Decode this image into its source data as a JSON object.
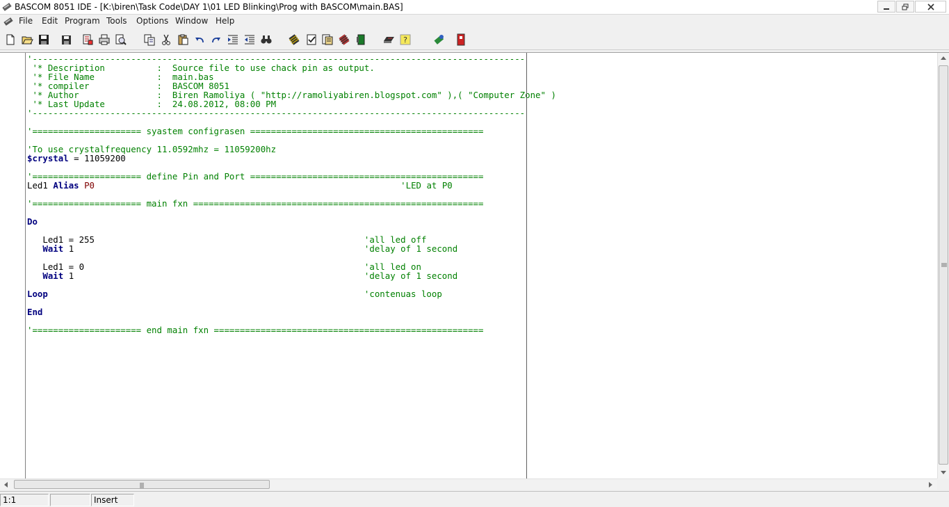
{
  "window": {
    "title": "BASCOM 8051 IDE - [K:\\biren\\Task Code\\DAY 1\\01 LED Blinking\\Prog with BASCOM\\main.BAS]",
    "controls": [
      "minimize",
      "restore",
      "close"
    ]
  },
  "menu": {
    "items": [
      "File",
      "Edit",
      "Program",
      "Tools",
      "Options",
      "Window",
      "Help"
    ]
  },
  "toolbar": {
    "buttons": [
      "new-file-icon",
      "open-folder-icon",
      "save-icon",
      "save-all-icon",
      "print-preview-icon",
      "print-icon",
      "zoom-icon",
      "copy-icon",
      "cut-icon",
      "paste-icon",
      "undo-icon",
      "redo-icon",
      "indent-icon",
      "outdent-icon",
      "find-icon",
      "compile-icon",
      "syntax-check-icon",
      "report-icon",
      "simulate-icon",
      "program-chip-icon",
      "terminal-icon",
      "help-icon",
      "lcd-designer-icon",
      "exit-icon"
    ]
  },
  "editor": {
    "lines": [
      [
        {
          "c": "cm",
          "t": "'-----------------------------------------------------------------------------------------------"
        }
      ],
      [
        {
          "c": "cm",
          "t": " '* Description          :  Source file to use chack pin as output."
        }
      ],
      [
        {
          "c": "cm",
          "t": " '* File Name            :  main.bas"
        }
      ],
      [
        {
          "c": "cm",
          "t": " '* compiler             :  BASCOM 8051"
        }
      ],
      [
        {
          "c": "cm",
          "t": " '* Author               :  Biren Ramoliya ( \"http://ramoliyabiren.blogspot.com\" ),( \"Computer Zone\" )"
        }
      ],
      [
        {
          "c": "cm",
          "t": " '* Last Update          :  24.08.2012, 08:00 PM"
        }
      ],
      [
        {
          "c": "cm",
          "t": "'-----------------------------------------------------------------------------------------------"
        }
      ],
      [],
      [
        {
          "c": "cm",
          "t": "'===================== syastem configrasen ============================================="
        }
      ],
      [],
      [
        {
          "c": "cm",
          "t": "'To use crystalfrequency 11.0592mhz = 11059200hz"
        }
      ],
      [
        {
          "c": "kw",
          "t": "$crystal"
        },
        {
          "c": "tx",
          "t": " = 11059200"
        }
      ],
      [],
      [
        {
          "c": "cm",
          "t": "'===================== define Pin and Port ============================================="
        }
      ],
      [
        {
          "c": "tx",
          "t": "Led1 "
        },
        {
          "c": "kw",
          "t": "Alias"
        },
        {
          "c": "tx",
          "t": " "
        },
        {
          "c": "pin",
          "t": "P0"
        },
        {
          "c": "tx",
          "t": "                                                           "
        },
        {
          "c": "cm",
          "t": "'LED at P0"
        }
      ],
      [],
      [
        {
          "c": "cm",
          "t": "'===================== main fxn ========================================================"
        }
      ],
      [],
      [
        {
          "c": "kw",
          "t": "Do"
        }
      ],
      [],
      [
        {
          "c": "tx",
          "t": "   Led1 = 255                                                    "
        },
        {
          "c": "cm",
          "t": "'all led off"
        }
      ],
      [
        {
          "c": "tx",
          "t": "   "
        },
        {
          "c": "kw",
          "t": "Wait"
        },
        {
          "c": "tx",
          "t": " 1                                                        "
        },
        {
          "c": "cm",
          "t": "'delay of 1 second"
        }
      ],
      [],
      [
        {
          "c": "tx",
          "t": "   Led1 = 0                                                      "
        },
        {
          "c": "cm",
          "t": "'all led on"
        }
      ],
      [
        {
          "c": "tx",
          "t": "   "
        },
        {
          "c": "kw",
          "t": "Wait"
        },
        {
          "c": "tx",
          "t": " 1                                                        "
        },
        {
          "c": "cm",
          "t": "'delay of 1 second"
        }
      ],
      [],
      [
        {
          "c": "kw",
          "t": "Loop"
        },
        {
          "c": "tx",
          "t": "                                                             "
        },
        {
          "c": "cm",
          "t": "'contenuas loop"
        }
      ],
      [],
      [
        {
          "c": "kw",
          "t": "End"
        }
      ],
      [],
      [
        {
          "c": "cm",
          "t": "'===================== end main fxn ===================================================="
        }
      ]
    ]
  },
  "statusbar": {
    "position": "1:1",
    "blank": "",
    "mode": "Insert"
  },
  "colors": {
    "comment": "#008000",
    "keyword": "#00007f",
    "port": "#7f0000"
  }
}
